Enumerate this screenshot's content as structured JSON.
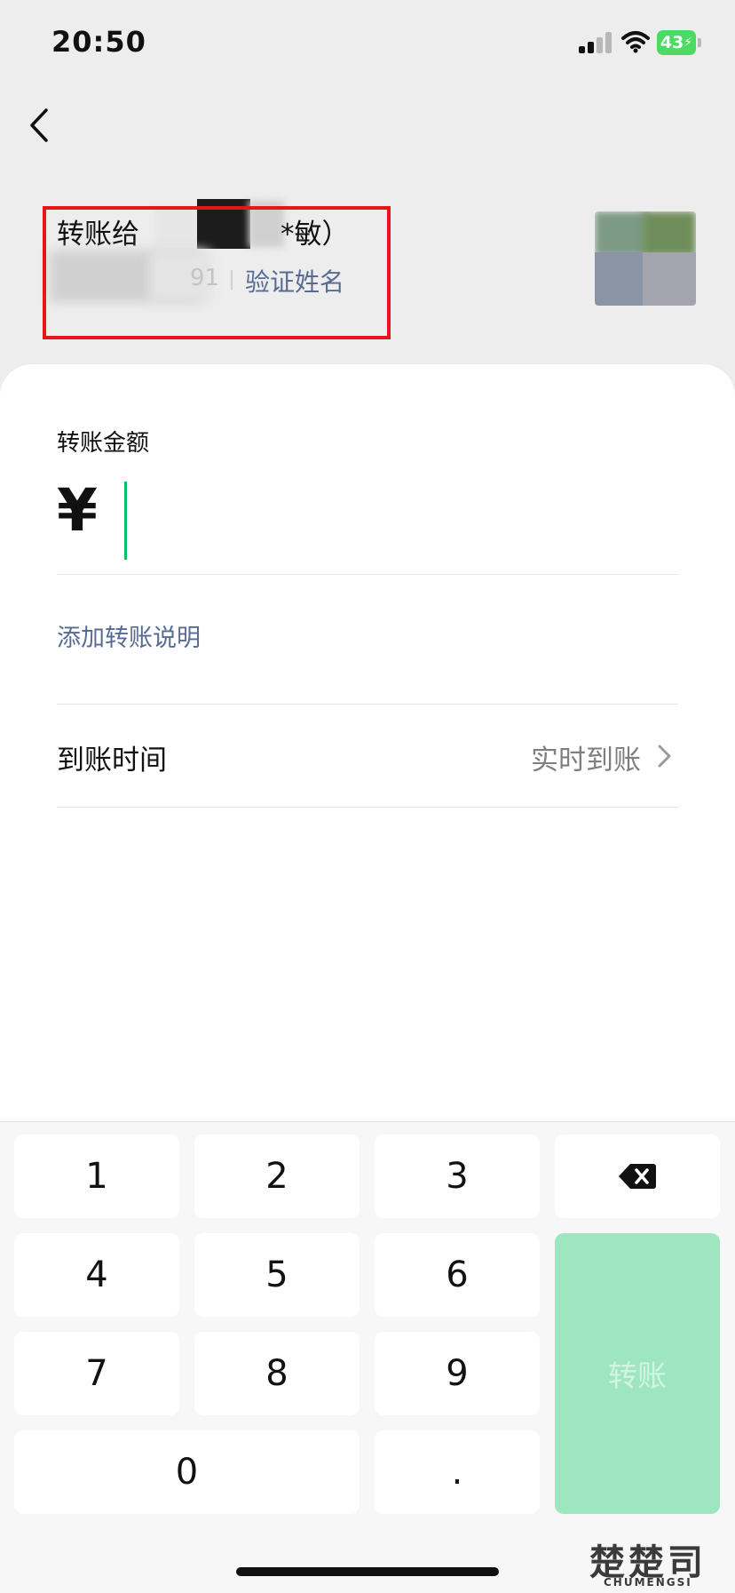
{
  "status_bar": {
    "time": "20:50",
    "battery": "43"
  },
  "payee": {
    "title_prefix": "转账给",
    "name_tail": "*敏）",
    "masked_digits": "91",
    "verify_label": "验证姓名"
  },
  "amount": {
    "label": "转账金额",
    "currency_symbol": "¥",
    "value": ""
  },
  "note": {
    "add_label": "添加转账说明"
  },
  "arrival": {
    "label": "到账时间",
    "value": "实时到账"
  },
  "keyboard": {
    "keys": [
      "1",
      "2",
      "3",
      "4",
      "5",
      "6",
      "7",
      "8",
      "9",
      "0",
      "."
    ],
    "transfer_label": "转账"
  },
  "watermark": {
    "main": "楚楚司",
    "sub": "CHUMENGSI"
  },
  "colors": {
    "accent_green": "#07c160",
    "link_blue": "#576b95",
    "highlight_red": "#e8131b",
    "transfer_disabled": "#9ee6bf"
  }
}
